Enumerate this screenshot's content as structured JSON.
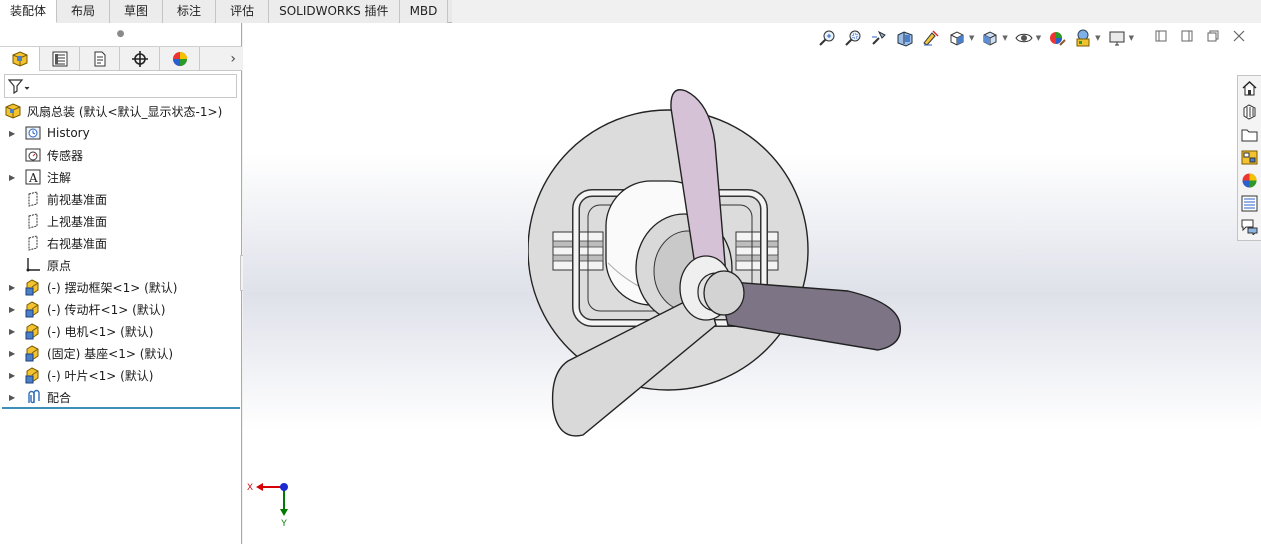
{
  "tabs": [
    {
      "label": "装配体",
      "active": true
    },
    {
      "label": "布局"
    },
    {
      "label": "草图"
    },
    {
      "label": "标注"
    },
    {
      "label": "评估"
    },
    {
      "label": "SOLIDWORKS 插件"
    },
    {
      "label": "MBD"
    }
  ],
  "manager_tabs": [
    {
      "icon": "featuremanager-icon",
      "active": true
    },
    {
      "icon": "propertymanager-icon"
    },
    {
      "icon": "configurationmanager-icon"
    },
    {
      "icon": "dimxpertmanager-icon"
    },
    {
      "icon": "displaymanager-icon"
    }
  ],
  "filter": {
    "icon": "filter-icon"
  },
  "tree": {
    "root": {
      "label": "风扇总装  (默认<默认_显示状态-1>)",
      "icon": "assembly-icon"
    },
    "items": [
      {
        "label": "History",
        "icon": "history-icon",
        "expandable": true
      },
      {
        "label": "传感器",
        "icon": "sensor-icon",
        "expandable": false
      },
      {
        "label": "注解",
        "icon": "annotation-icon",
        "expandable": true
      },
      {
        "label": "前视基准面",
        "icon": "plane-icon",
        "expandable": false
      },
      {
        "label": "上视基准面",
        "icon": "plane-icon",
        "expandable": false
      },
      {
        "label": "右视基准面",
        "icon": "plane-icon",
        "expandable": false
      },
      {
        "label": "原点",
        "icon": "origin-icon",
        "expandable": false
      },
      {
        "label": "(-) 摆动框架<1> (默认)",
        "icon": "part-icon",
        "expandable": true
      },
      {
        "label": "(-) 传动杆<1> (默认)",
        "icon": "part-icon",
        "expandable": true
      },
      {
        "label": "(-) 电机<1> (默认)",
        "icon": "part-icon",
        "expandable": true
      },
      {
        "label": "(固定) 基座<1> (默认)",
        "icon": "part-icon",
        "expandable": true
      },
      {
        "label": "(-) 叶片<1> (默认)",
        "icon": "part-icon",
        "expandable": true
      },
      {
        "label": "配合",
        "icon": "mates-icon",
        "expandable": true
      }
    ]
  },
  "heads_up_toolbar": [
    "zoom-to-fit-icon",
    "zoom-to-area-icon",
    "previous-view-icon",
    "section-view-icon",
    "dynamic-annotation-icon",
    "view-orientation-icon",
    "display-style-icon",
    "hide-show-icon",
    "edit-appearance-icon",
    "apply-scene-icon",
    "view-settings-icon"
  ],
  "task_pane": [
    "home-icon",
    "design-library-icon",
    "file-explorer-icon",
    "view-palette-icon",
    "appearances-icon",
    "custom-properties-icon",
    "forum-icon"
  ],
  "triad": {
    "x_label": "X",
    "y_label": "Y"
  },
  "colors": {
    "blade": "#d6c2d6",
    "blade_dark": "#7d7585",
    "blade_grey": "#d9d9d9",
    "base": "#dcdcdc",
    "triad_x": "#d60000",
    "triad_y": "#007a00",
    "triad_z": "#1c2bd0",
    "tree_end_bar": "#3c8fb7"
  }
}
